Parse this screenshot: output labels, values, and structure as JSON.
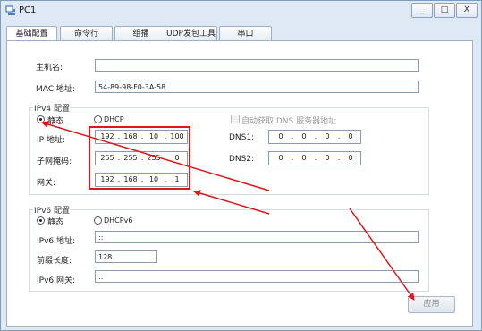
{
  "window": {
    "title": "PC1",
    "controls": [
      "_",
      "□",
      "X"
    ]
  },
  "tabs": [
    "基础配置",
    "命令行",
    "组播",
    "UDP发包工具",
    "串口"
  ],
  "basic": {
    "hostname_label": "主机名:",
    "hostname_value": "",
    "mac_label": "MAC 地址:",
    "mac_value": "54-89-98-F0-3A-58"
  },
  "ipv4": {
    "group_title": "IPv4 配置",
    "static_label": "静态",
    "dhcp_label": "DHCP",
    "auto_dns_label": "自动获取 DNS 服务器地址",
    "ip_label": "IP 地址:",
    "ip_octets": [
      "192",
      "168",
      "10",
      "100"
    ],
    "mask_label": "子网掩码:",
    "mask_octets": [
      "255",
      "255",
      "255",
      "0"
    ],
    "gateway_label": "网关:",
    "gateway_octets": [
      "192",
      "168",
      "10",
      "1"
    ],
    "dns1_label": "DNS1:",
    "dns1_octets": [
      "0",
      "0",
      "0",
      "0"
    ],
    "dns2_label": "DNS2:",
    "dns2_octets": [
      "0",
      "0",
      "0",
      "0"
    ],
    "octet_separator": "."
  },
  "ipv6": {
    "group_title": "IPv6 配置",
    "static_label": "静态",
    "dhcpv6_label": "DHCPv6",
    "addr_label": "IPv6 地址:",
    "addr_value": "::",
    "prefix_label": "前缀长度:",
    "prefix_value": "128",
    "gateway_label": "IPv6 网关:",
    "gateway_value": "::"
  },
  "apply_label": "应用",
  "colors": {
    "annotation": "#e0161b",
    "window_bg": "#dfe9f5",
    "content_bg": "#ffffff"
  }
}
